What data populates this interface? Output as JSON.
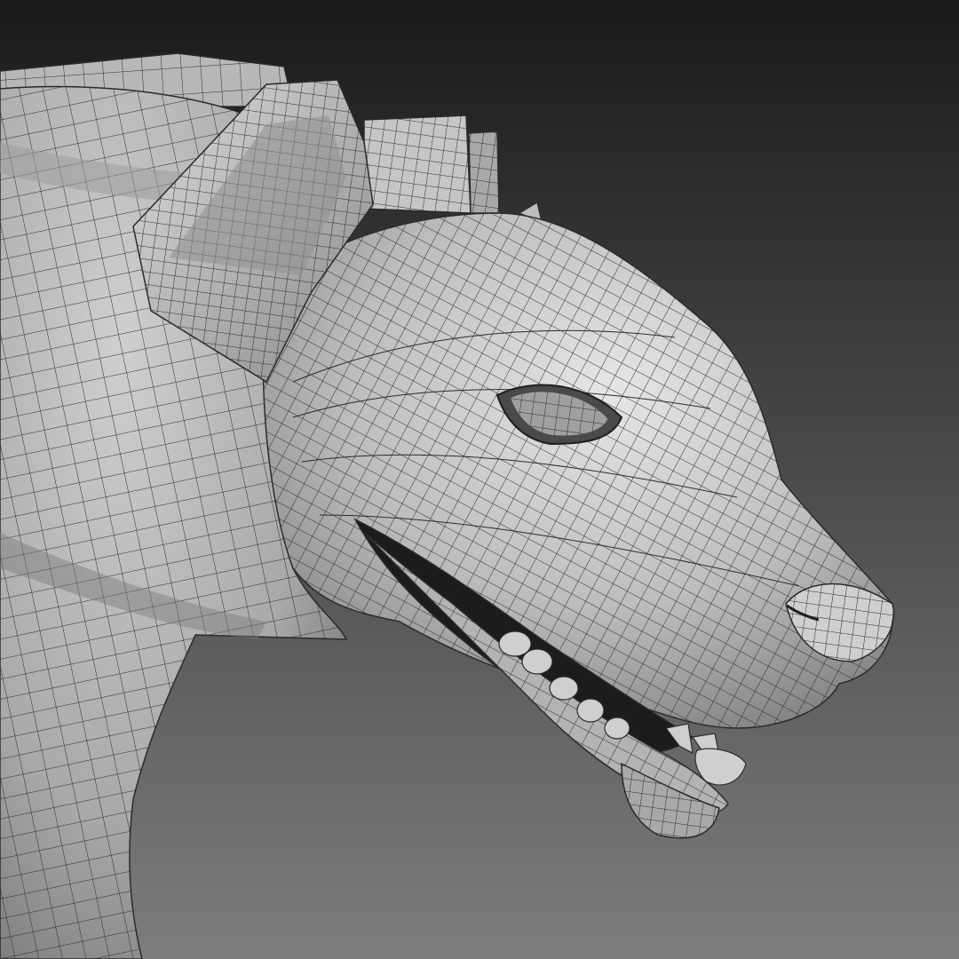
{
  "scene": {
    "subject": "hyena-head-wireframe-render",
    "colors": {
      "background_top": "#1a1a1a",
      "background_bottom": "#7d7d7d",
      "mesh_fill": "#bdbdbd",
      "mesh_highlight": "#e6e6e6",
      "mesh_shadow": "#6a6a6a",
      "wire": "#2b2b2b",
      "mouth_interior": "#1c1c1c",
      "teeth": "#cfcfcf"
    }
  }
}
